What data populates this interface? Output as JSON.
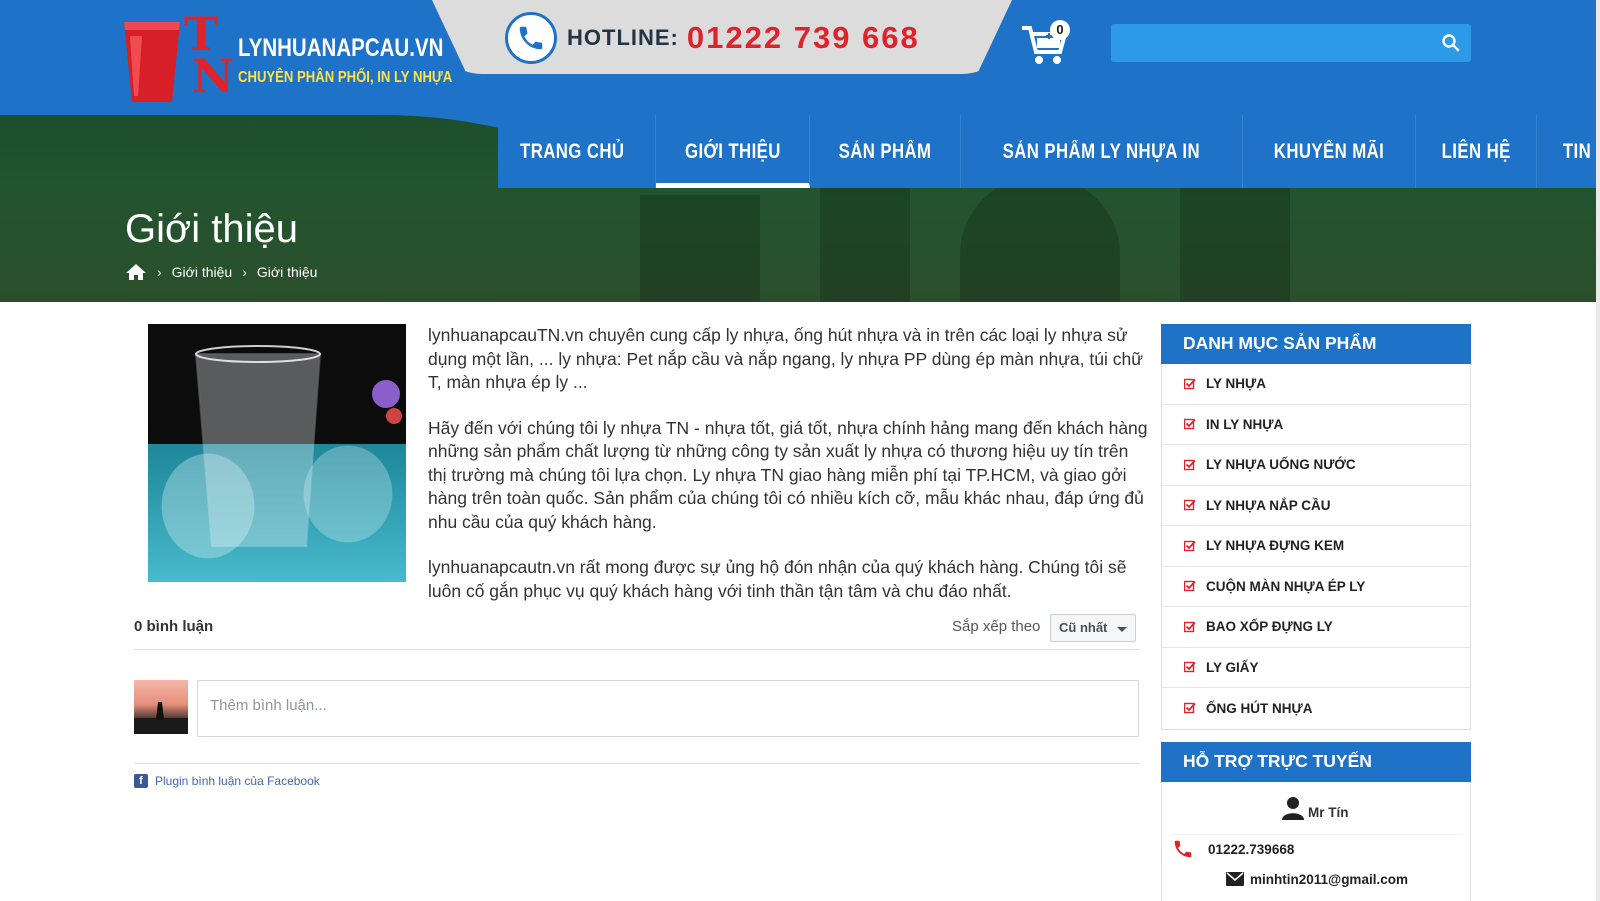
{
  "header": {
    "logo_letters_t": "T",
    "logo_letters_n": "N",
    "site_name": "LYNHUANAPCAU.VN",
    "tagline": "CHUYÊN PHÂN PHỐI, IN LY NHỰA",
    "hotline_label": "HOTLINE:",
    "hotline_number": "01222 739 668",
    "cart_count": "0",
    "search_placeholder": "",
    "brand_color": "#1e73c8",
    "accent_color": "#e0232b"
  },
  "nav": {
    "items": [
      {
        "label": "TRANG CHỦ"
      },
      {
        "label": "GIỚI THIỆU"
      },
      {
        "label": "SẢN PHẨM"
      },
      {
        "label": "SẢN PHẨM LY NHỰA IN"
      },
      {
        "label": "KHUYẾN MÃI"
      },
      {
        "label": "LIÊN HỆ"
      },
      {
        "label": "TIN TỨC"
      }
    ],
    "active_index": 1
  },
  "banner": {
    "title": "Giới thiệu",
    "breadcrumb": [
      "Giới thiệu",
      "Giới thiệu"
    ]
  },
  "content": {
    "paragraphs": [
      "lynhuanapcauTN.vn  chuyên cung cấp ly nhựa, ống hút nhựa và in trên các loại ly nhựa sử dụng một lần, ... ly nhựa:  Pet nắp cầu và nắp ngang, ly nhựa PP dùng ép màn nhựa,  túi chữ T, màn nhựa ép ly ...",
      "Hãy đến với chúng tôi  ly nhựa TN - nhựa tốt, giá tốt, nhựa chính hảng mang đến khách hàng những sản phẩm chất lượng từ những công ty sản xuất ly nhựa có thương hiệu uy tín trên thị trường mà chúng tôi lựa chọn. Ly nhựa TN giao hàng miễn phí tại TP.HCM, và giao gởi hàng trên toàn quốc.  Sản phẩm của chúng tôi có nhiều  kích cỡ, mẫu khác nhau, đáp ứng đủ nhu cầu của quý khách hàng.",
      "lynhuanapcautn.vn rất mong được sự ủng hộ đón nhận của quý khách hàng. Chúng tôi sẽ luôn  cố gắn phục vụ quý khách hàng với tinh thần tận tâm và chu đáo nhất."
    ]
  },
  "comments": {
    "count_label": "0 bình luận",
    "sort_label": "Sắp xếp theo",
    "sort_value": "Cũ nhất",
    "input_placeholder": "Thêm bình luận...",
    "plugin_label": "Plugin bình luận của Facebook"
  },
  "sidebar": {
    "categories_title": "DANH MỤC SẢN PHẨM",
    "categories": [
      "LY NHỰA",
      "IN LY NHỰA",
      "LY NHỰA UỐNG NƯỚC",
      "LY NHỰA NẮP CẦU",
      "LY NHỰA ĐỰNG KEM",
      "CUỘN MÀN NHỰA ÉP LY",
      "BAO XỐP ĐỰNG LY",
      "LY GIẤY",
      "ỐNG HÚT NHỰA"
    ],
    "support_title": "HỖ TRỢ TRỰC TUYẾN",
    "support_name": "Mr Tín",
    "support_phone": "01222.739668",
    "support_email": "minhtin2011@gmail.com"
  }
}
